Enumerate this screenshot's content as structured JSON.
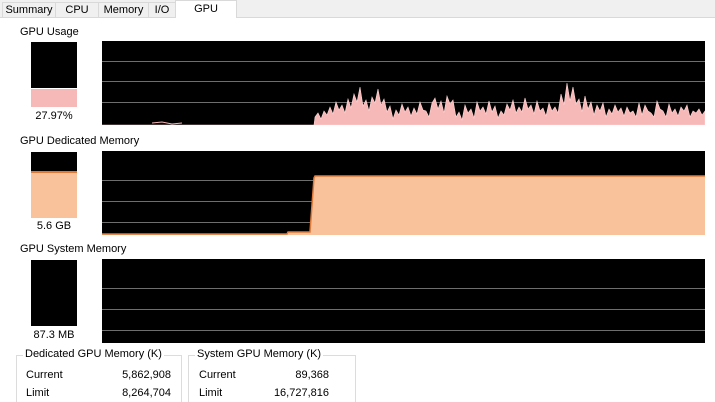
{
  "tabs": [
    {
      "label": "Summary",
      "active": false
    },
    {
      "label": "CPU",
      "active": false
    },
    {
      "label": "Memory",
      "active": false
    },
    {
      "label": "I/O",
      "active": false
    },
    {
      "label": "GPU",
      "active": true
    }
  ],
  "gpu_usage": {
    "title": "GPU Usage",
    "value": "27.97%",
    "fill_fraction": 0.28,
    "color": "#f7b8b8"
  },
  "gpu_dedicated": {
    "title": "GPU Dedicated Memory",
    "value": "5.6 GB",
    "fill_fraction": 0.68,
    "color": "#f9c29b",
    "edge_color": "#e07a3a"
  },
  "gpu_system": {
    "title": "GPU System Memory",
    "value": "87.3 MB",
    "fill_fraction": 0.0
  },
  "dedicated_group": {
    "title": "Dedicated GPU Memory (K)",
    "rows": [
      {
        "label": "Current",
        "value": "5,862,908"
      },
      {
        "label": "Limit",
        "value": "8,264,704"
      }
    ]
  },
  "system_group": {
    "title": "System GPU Memory (K)",
    "rows": [
      {
        "label": "Current",
        "value": "89,368"
      },
      {
        "label": "Limit",
        "value": "16,727,816"
      }
    ]
  }
}
